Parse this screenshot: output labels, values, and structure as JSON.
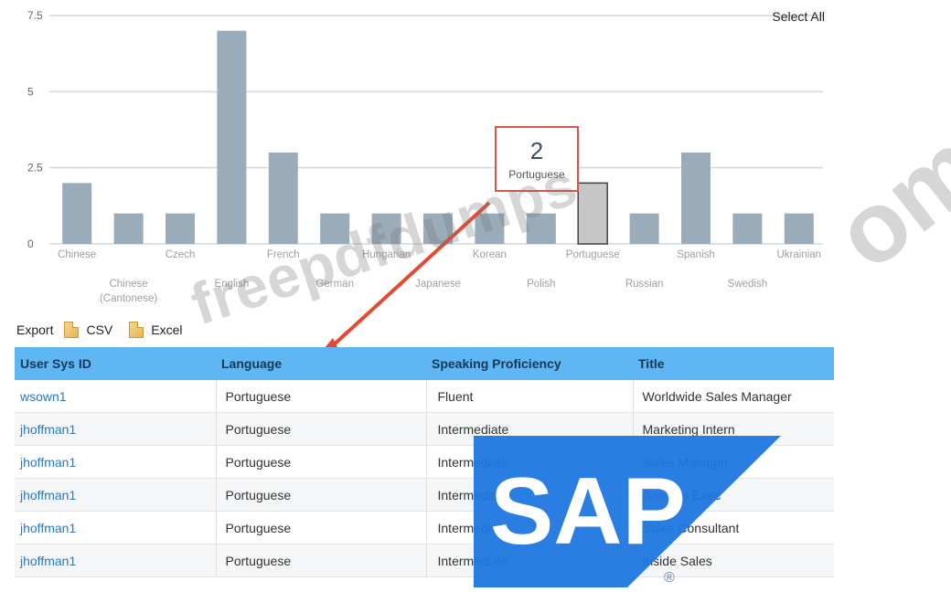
{
  "chart_data": {
    "type": "bar",
    "categories": [
      "Chinese",
      "Chinese (Cantonese)",
      "Czech",
      "English",
      "French",
      "German",
      "Hungarian",
      "Japanese",
      "Korean",
      "Polish",
      "Portuguese",
      "Russian",
      "Spanish",
      "Swedish",
      "Ukrainian"
    ],
    "values": [
      2,
      1,
      1,
      7,
      3,
      1,
      1,
      1,
      1,
      1,
      2,
      1,
      3,
      1,
      1
    ],
    "y_ticks": [
      "0",
      "2.5",
      "5",
      "7.5"
    ],
    "ylim": [
      0,
      7.5
    ],
    "selected_category": "Portuguese",
    "colors": {
      "bar": "#9aabb9",
      "selected_bar": "#c6c6c6",
      "gridline": "#d0d8e2"
    }
  },
  "select_all_label": "Select All",
  "tooltip": {
    "value": "2",
    "label": "Portuguese"
  },
  "export": {
    "label": "Export",
    "csv_label": "CSV",
    "excel_label": "Excel"
  },
  "table": {
    "columns": [
      "User Sys ID",
      "Language",
      "Speaking Proficiency",
      "Title"
    ],
    "rows": [
      [
        "wsown1",
        "Portuguese",
        "Fluent",
        "Worldwide Sales Manager"
      ],
      [
        "jhoffman1",
        "Portuguese",
        "Intermediate",
        "Marketing Intern"
      ],
      [
        "jhoffman1",
        "Portuguese",
        "Intermediate",
        "Sales Manager"
      ],
      [
        "jhoffman1",
        "Portuguese",
        "Intermediate",
        "Account Exec"
      ],
      [
        "jhoffman1",
        "Portuguese",
        "Intermediate",
        "Sales Consultant"
      ],
      [
        "jhoffman1",
        "Portuguese",
        "Intermediate",
        "Inside Sales"
      ]
    ]
  },
  "logo": {
    "text": "SAP",
    "registered": "®",
    "colors": {
      "blue": "#1f77e0",
      "text": "#ffffff"
    }
  },
  "watermark": {
    "text": "freepdfdumps",
    "edge_text": "om"
  }
}
